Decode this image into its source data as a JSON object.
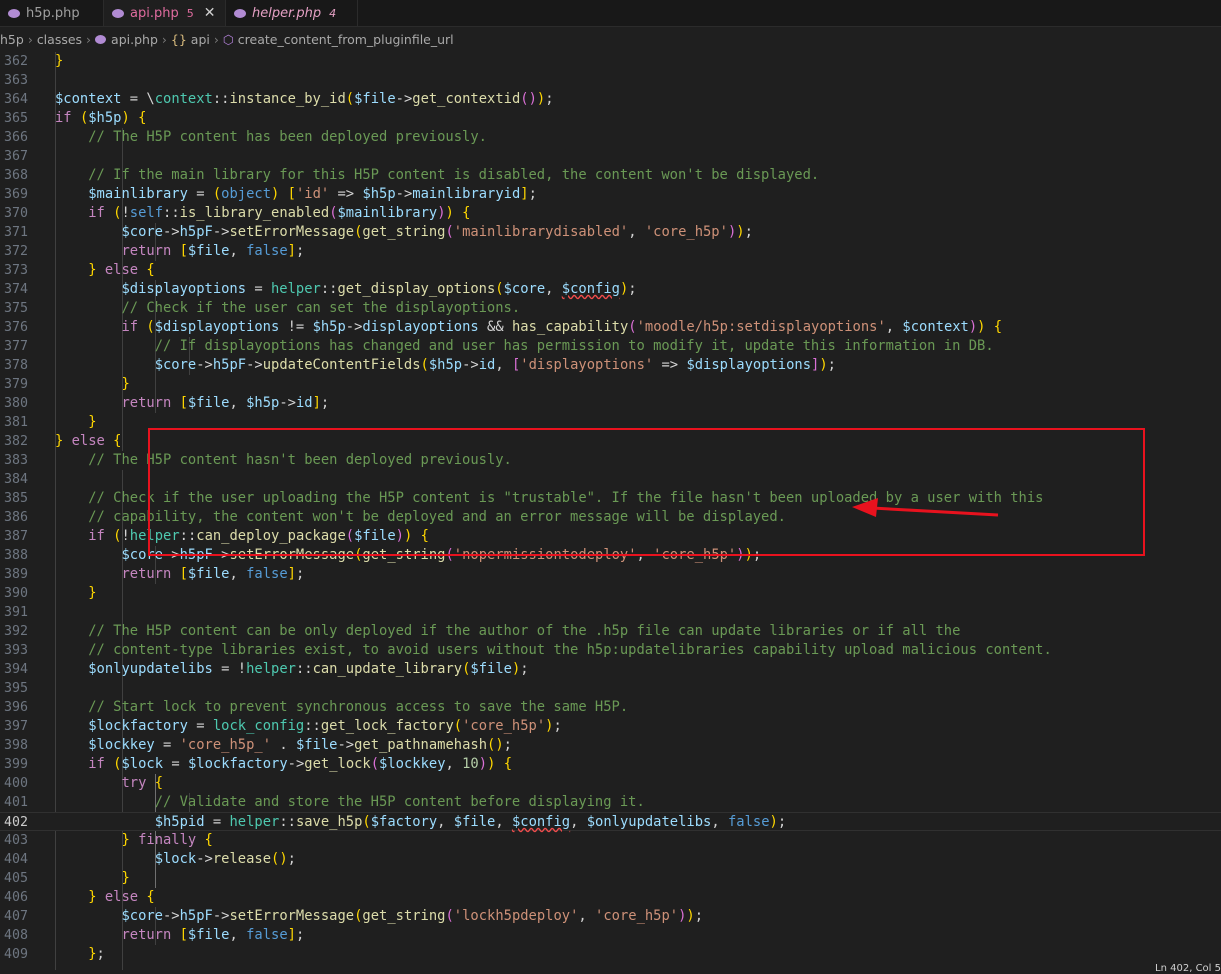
{
  "tabs": [
    {
      "name": "h5p.php",
      "badge": "",
      "active": false
    },
    {
      "name": "api.php",
      "badge": "5",
      "active": true
    },
    {
      "name": "helper.php",
      "badge": "4",
      "active": false
    }
  ],
  "breadcrumb": [
    "h5p",
    "classes",
    "api.php",
    "api",
    "create_content_from_pluginfile_url"
  ],
  "status_fragment": "Ln 402, Col 5",
  "current_line": 402,
  "lines": [
    {
      "n": "362",
      "t": "            }"
    },
    {
      "n": "363",
      "t": ""
    },
    {
      "n": "364",
      "t": "            $context = \\context::instance_by_id($file->get_contextid());"
    },
    {
      "n": "365",
      "t": "            if ($h5p) {"
    },
    {
      "n": "366",
      "t": "                // The H5P content has been deployed previously."
    },
    {
      "n": "367",
      "t": ""
    },
    {
      "n": "368",
      "t": "                // If the main library for this H5P content is disabled, the content won't be displayed."
    },
    {
      "n": "369",
      "t": "                $mainlibrary = (object) ['id' => $h5p->mainlibraryid];"
    },
    {
      "n": "370",
      "t": "                if (!self::is_library_enabled($mainlibrary)) {"
    },
    {
      "n": "371",
      "t": "                    $core->h5pF->setErrorMessage(get_string('mainlibrarydisabled', 'core_h5p'));"
    },
    {
      "n": "372",
      "t": "                    return [$file, false];"
    },
    {
      "n": "373",
      "t": "                } else {"
    },
    {
      "n": "374",
      "t": "                    $displayoptions = helper::get_display_options($core, $config);"
    },
    {
      "n": "375",
      "t": "                    // Check if the user can set the displayoptions."
    },
    {
      "n": "376",
      "t": "                    if ($displayoptions != $h5p->displayoptions && has_capability('moodle/h5p:setdisplayoptions', $context)) {"
    },
    {
      "n": "377",
      "t": "                        // If displayoptions has changed and user has permission to modify it, update this information in DB."
    },
    {
      "n": "378",
      "t": "                        $core->h5pF->updateContentFields($h5p->id, ['displayoptions' => $displayoptions]);"
    },
    {
      "n": "379",
      "t": "                    }"
    },
    {
      "n": "380",
      "t": "                    return [$file, $h5p->id];"
    },
    {
      "n": "381",
      "t": "                }"
    },
    {
      "n": "382",
      "t": "            } else {"
    },
    {
      "n": "383",
      "t": "                // The H5P content hasn't been deployed previously."
    },
    {
      "n": "384",
      "t": ""
    },
    {
      "n": "385",
      "t": "                // Check if the user uploading the H5P content is \"trustable\". If the file hasn't been uploaded by a user with this"
    },
    {
      "n": "386",
      "t": "                // capability, the content won't be deployed and an error message will be displayed."
    },
    {
      "n": "387",
      "t": "                if (!helper::can_deploy_package($file)) {"
    },
    {
      "n": "388",
      "t": "                    $core->h5pF->setErrorMessage(get_string('nopermissiontodeploy', 'core_h5p'));"
    },
    {
      "n": "389",
      "t": "                    return [$file, false];"
    },
    {
      "n": "390",
      "t": "                }"
    },
    {
      "n": "391",
      "t": ""
    },
    {
      "n": "392",
      "t": "                // The H5P content can be only deployed if the author of the .h5p file can update libraries or if all the"
    },
    {
      "n": "393",
      "t": "                // content-type libraries exist, to avoid users without the h5p:updatelibraries capability upload malicious content."
    },
    {
      "n": "394",
      "t": "                $onlyupdatelibs = !helper::can_update_library($file);"
    },
    {
      "n": "395",
      "t": ""
    },
    {
      "n": "396",
      "t": "                // Start lock to prevent synchronous access to save the same H5P."
    },
    {
      "n": "397",
      "t": "                $lockfactory = lock_config::get_lock_factory('core_h5p');"
    },
    {
      "n": "398",
      "t": "                $lockkey = 'core_h5p_' . $file->get_pathnamehash();"
    },
    {
      "n": "399",
      "t": "                if ($lock = $lockfactory->get_lock($lockkey, 10)) {"
    },
    {
      "n": "400",
      "t": "                    try {"
    },
    {
      "n": "401",
      "t": "                        // Validate and store the H5P content before displaying it."
    },
    {
      "n": "402",
      "t": "                        $h5pid = helper::save_h5p($factory, $file, $config, $onlyupdatelibs, false);"
    },
    {
      "n": "403",
      "t": "                    } finally {"
    },
    {
      "n": "404",
      "t": "                        $lock->release();"
    },
    {
      "n": "405",
      "t": "                    }"
    },
    {
      "n": "406",
      "t": "                } else {"
    },
    {
      "n": "407",
      "t": "                    $core->h5pF->setErrorMessage(get_string('lockh5pdeploy', 'core_h5p'));"
    },
    {
      "n": "408",
      "t": "                    return [$file, false];"
    },
    {
      "n": "409",
      "t": "                };"
    }
  ]
}
